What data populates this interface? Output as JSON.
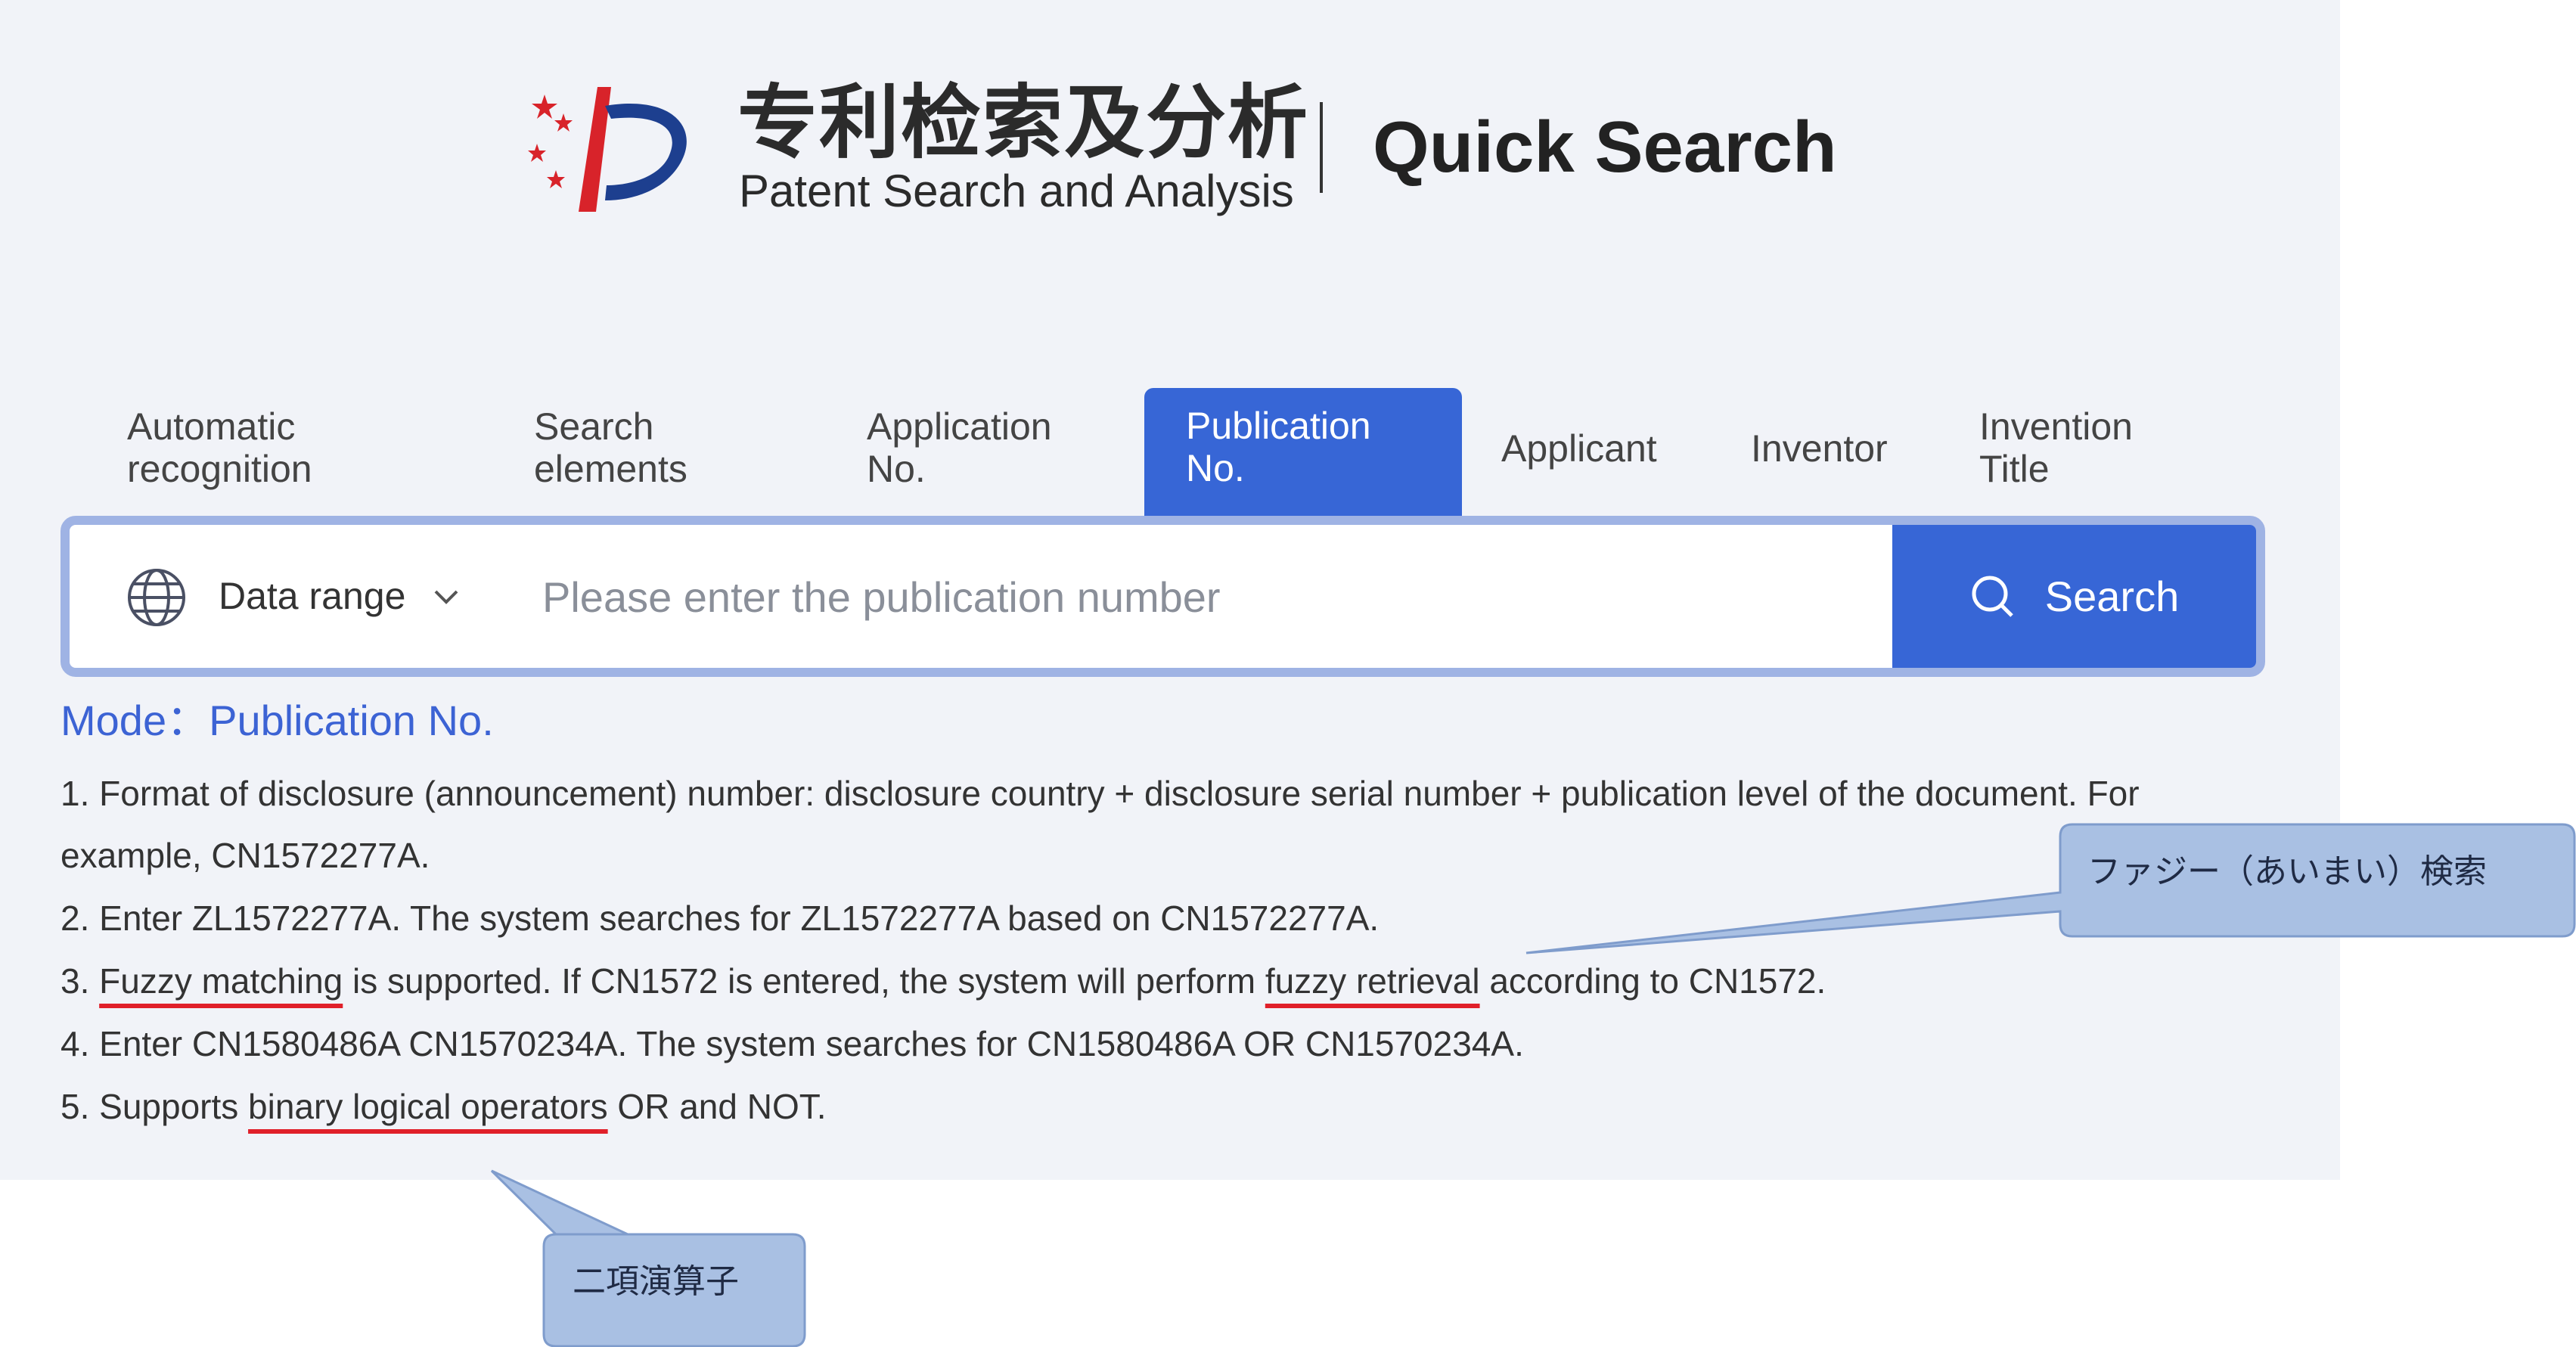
{
  "header": {
    "logo_cn": "专利检索及分析",
    "logo_en": "Patent Search and Analysis",
    "title": "Quick Search"
  },
  "tabs": [
    {
      "label": "Automatic\nrecognition",
      "active": false
    },
    {
      "label": "Search\nelements",
      "active": false
    },
    {
      "label": "Application\nNo.",
      "active": false
    },
    {
      "label": "Publication\nNo.",
      "active": true
    },
    {
      "label": "Applicant",
      "active": false
    },
    {
      "label": "Inventor",
      "active": false
    },
    {
      "label": "Invention\nTitle",
      "active": false
    }
  ],
  "search": {
    "data_range_label": "Data range",
    "placeholder": "Please enter the publication number",
    "button_label": "Search"
  },
  "mode": {
    "label": "Mode",
    "value": "Publication No."
  },
  "instructions": {
    "line1": "1. Format of disclosure (announcement) number: disclosure country + disclosure serial number + publication level of the document. For",
    "line1b": "example, CN1572277A.",
    "line2": "2. Enter ZL1572277A. The system searches for ZL1572277A based on CN1572277A.",
    "line3_a": "3. ",
    "line3_ul1": "Fuzzy matching",
    "line3_b": " is supported. If CN1572 is entered, the system will perform ",
    "line3_ul2": "fuzzy retrieval",
    "line3_c": " according to CN1572.",
    "line4": "4. Enter CN1580486A CN1570234A. The system searches for CN1580486A OR CN1570234A.",
    "line5_a": "5. Supports ",
    "line5_ul": "binary logical operators",
    "line5_b": " OR and NOT."
  },
  "annotations": {
    "fuzzy": "ファジー（あいまい）検索",
    "binary": "二項演算子"
  },
  "colors": {
    "accent": "#3766d6",
    "underline": "#e0202a",
    "callout_fill": "#a9c0e3",
    "panel_bg": "#f1f3f8"
  }
}
